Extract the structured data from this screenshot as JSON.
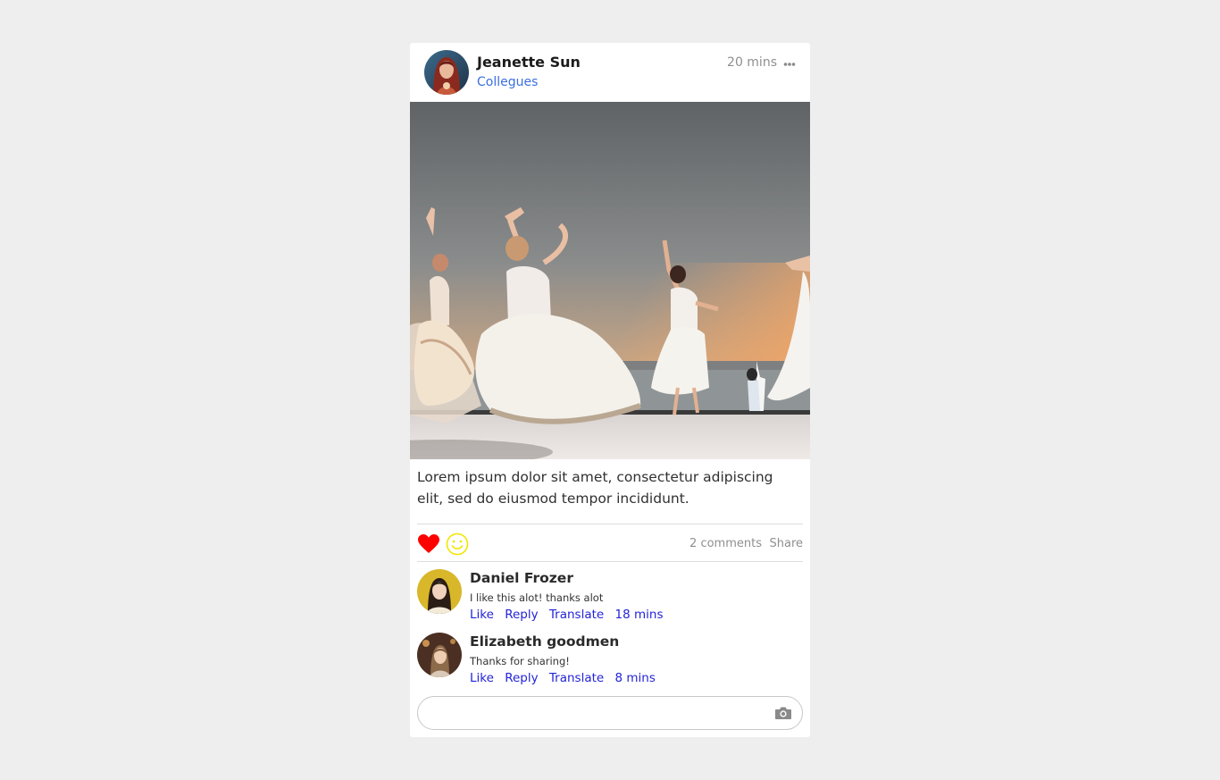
{
  "post": {
    "author": "Jeanette Sun",
    "audience": "Collegues",
    "time": "20 mins",
    "text": "Lorem ipsum dolor sit amet, consectetur adipiscing elit, sed do eiusmod tempor incididunt."
  },
  "reactions": {
    "comments_count": "2 comments",
    "share_label": "Share",
    "heart_color": "#ff0000",
    "smile_color": "#f2e600"
  },
  "comments": [
    {
      "author": "Daniel Frozer",
      "text": "I like this alot! thanks alot",
      "like": "Like",
      "reply": "Reply",
      "translate": "Translate",
      "time": "18 mins"
    },
    {
      "author": "Elizabeth goodmen",
      "text": "Thanks for sharing!",
      "like": "Like",
      "reply": "Reply",
      "translate": "Translate",
      "time": "8 mins"
    }
  ],
  "comment_input": {
    "placeholder": "",
    "value": ""
  },
  "colors": {
    "link": "#3b6fe0",
    "action": "#2323d9",
    "muted": "#8f8f8f"
  },
  "icons": {
    "more": "more-dots-icon",
    "heart": "heart-icon",
    "smile": "smile-icon",
    "camera": "camera-icon"
  }
}
